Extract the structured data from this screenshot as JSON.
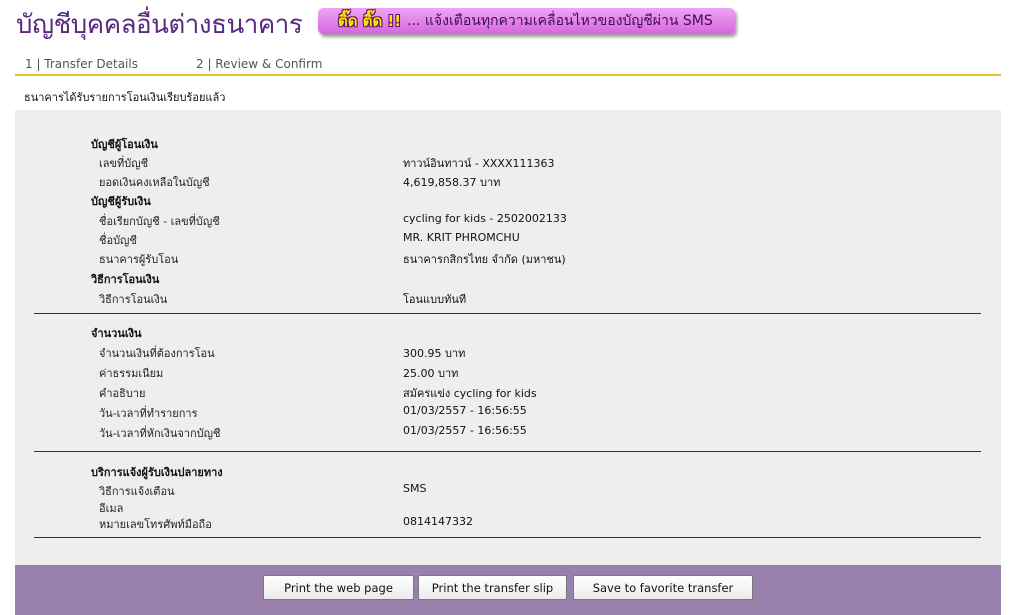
{
  "header": {
    "title": "บัญชีบุคคลอื่นต่างธนาคาร",
    "banner_hot": "ติ๊ด ติ๊ด !!",
    "banner_text": "... แจ้งเตือนทุกความเคลื่อนไหวของบัญชีผ่าน SMS"
  },
  "steps": {
    "step1": "1 | Transfer Details",
    "step2": "2 | Review & Confirm"
  },
  "status_message": "ธนาคารได้รับรายการโอนเงินเรียบร้อยแล้ว",
  "from_account": {
    "heading": "บัญชีผู้โอนเงิน",
    "rows": [
      {
        "label": "เลขที่บัญชี",
        "value": "ทาวน์อินทาวน์ - XXXX111363"
      },
      {
        "label": "ยอดเงินคงเหลือในบัญชี",
        "value": "4,619,858.37 บาท"
      }
    ]
  },
  "to_account": {
    "heading": "บัญชีผู้รับเงิน",
    "rows": [
      {
        "label": "ชื่อเรียกบัญชี - เลขที่บัญชี",
        "value": "cycling for kids - 2502002133"
      },
      {
        "label": "ชื่อบัญชี",
        "value": "MR. KRIT PHROMCHU"
      },
      {
        "label": "ธนาคารผู้รับโอน",
        "value": "ธนาคารกสิกรไทย จำกัด (มหาชน)"
      }
    ]
  },
  "method": {
    "heading": "วิธีการโอนเงิน",
    "rows": [
      {
        "label": "วิธีการโอนเงิน",
        "value": "โอนแบบทันที"
      }
    ]
  },
  "amount": {
    "heading": "จำนวนเงิน",
    "rows": [
      {
        "label": "จำนวนเงินที่ต้องการโอน",
        "value": "300.95 บาท"
      },
      {
        "label": "ค่าธรรมเนียม",
        "value": "25.00  บาท"
      },
      {
        "label": "คำอธิบาย",
        "value": "สมัครแข่ง cycling for kids"
      },
      {
        "label": "วัน-เวลาที่ทำรายการ",
        "value": "01/03/2557 - 16:56:55"
      },
      {
        "label": "วัน-เวลาที่หักเงินจากบัญชี",
        "value": "01/03/2557 - 16:56:55"
      }
    ]
  },
  "notify": {
    "heading": "บริการแจ้งผู้รับเงินปลายทาง",
    "rows": [
      {
        "label": "วิธีการแจ้งเตือน",
        "value": "SMS"
      },
      {
        "label": "อีเมล",
        "value": ""
      },
      {
        "label": "หมายเลขโทรศัพท์มือถือ",
        "value": "0814147332"
      }
    ]
  },
  "buttons": {
    "print_page": "Print the web page",
    "print_slip": "Print the transfer slip",
    "save_favorite": "Save to favorite transfer"
  },
  "colors": {
    "title": "#5a2a80",
    "step_rule": "#e8c23a",
    "panel_bg": "#eeeeee",
    "footer_bg": "#9a80ac"
  }
}
